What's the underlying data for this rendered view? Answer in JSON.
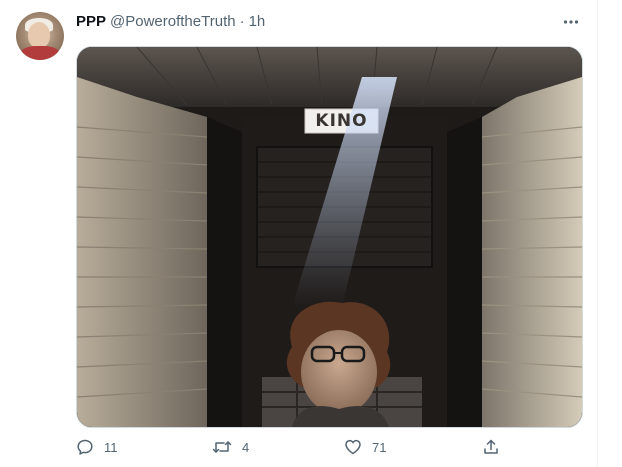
{
  "tweet": {
    "name": "PPP",
    "handle": "@PoweroftheTruth",
    "separator": "·",
    "time": "1h",
    "media": {
      "sign_text": "KINO"
    },
    "actions": {
      "replies": "11",
      "retweets": "4",
      "likes": "71"
    }
  },
  "icons": {
    "more": "more-horizontal-icon",
    "reply": "reply-icon",
    "retweet": "retweet-icon",
    "like": "heart-icon",
    "share": "share-icon"
  },
  "colors": {
    "text_primary": "#0f1419",
    "text_secondary": "#536471",
    "border": "#cfd9de"
  }
}
